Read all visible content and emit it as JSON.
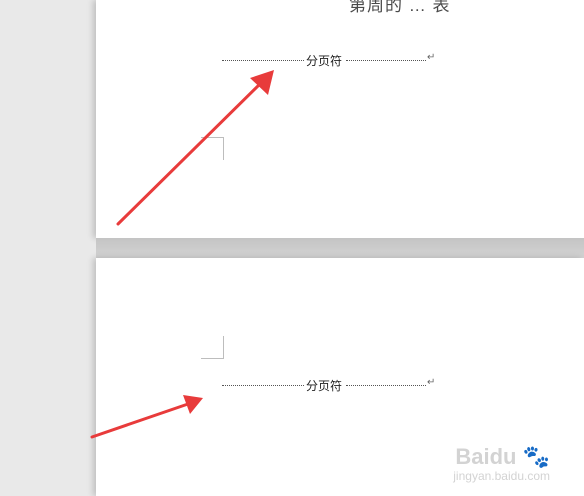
{
  "document": {
    "heading_partial": "第周的 … 表",
    "page_break_label": "分页符",
    "paragraph_mark": "↵",
    "annotation_color": "#e83b3b"
  },
  "watermark": {
    "brand": "Baidu",
    "sub": "jingyan.baidu.com",
    "icons": [
      "paw-icon"
    ]
  }
}
